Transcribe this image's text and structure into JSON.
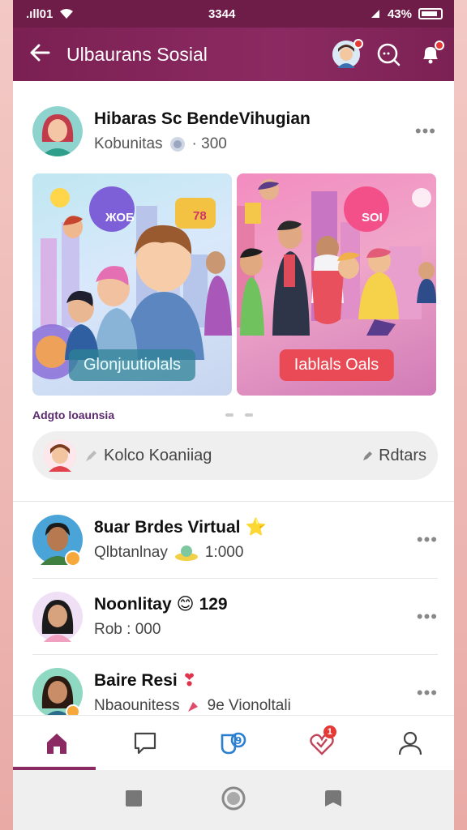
{
  "status": {
    "signal": ".ıll01",
    "time": "3344",
    "battery": "43%"
  },
  "appbar": {
    "title": "Ulbaurans Sosial"
  },
  "post": {
    "name": "Hibaras Sc BendeVihugian",
    "sub": "Kobunitas",
    "count": "· 300"
  },
  "cards": [
    {
      "label": "Glonjuutiolals",
      "bubble": "ЖОБ",
      "bubble2": "78"
    },
    {
      "label": "Iablals Oals",
      "bubble": "SOI"
    }
  ],
  "section": {
    "label": "Adgto loaunsia"
  },
  "comment": {
    "placeholder": "Kolco Koaniiag",
    "action": "Rdtars"
  },
  "list": [
    {
      "name": "8uar Brdes Virtual",
      "sub": "Qlbtanlnay",
      "count": "1:000",
      "emoji": "⭐"
    },
    {
      "name": "Noonlitay",
      "sub": "Rob : 000",
      "count": "129",
      "emoji": "😊"
    },
    {
      "name": "Baire Resi",
      "sub": "Nbaounitess",
      "count": "9e Vionoltali",
      "emoji": "❣"
    }
  ],
  "nav": {
    "badge": "1"
  },
  "colors": {
    "primary": "#7b2052",
    "status": "#6e1d49",
    "accent": "#e53935"
  }
}
